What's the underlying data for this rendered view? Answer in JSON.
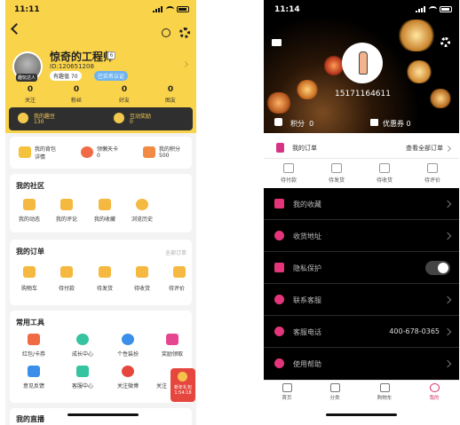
{
  "left": {
    "status_time": "11:11",
    "user": {
      "name": "惊奇的工程师",
      "id_text": "ID:120651208",
      "interest_badge": "有趣值 70",
      "verify_badge": "已实名认证",
      "avatar_tag": "趣玩达人"
    },
    "stats": [
      {
        "value": "0",
        "label": "关注"
      },
      {
        "value": "0",
        "label": "粉丝"
      },
      {
        "value": "0",
        "label": "好友"
      },
      {
        "value": "0",
        "label": "图友"
      }
    ],
    "beans": {
      "label": "我的趣豆",
      "value": "130"
    },
    "rewards": {
      "label": "互动奖励",
      "value": "0"
    },
    "quick": [
      {
        "label": "我的背包",
        "sub": "详情"
      },
      {
        "label": "领懒天卡",
        "sub": "0"
      },
      {
        "label": "我的积分",
        "sub": "500"
      }
    ],
    "community": {
      "title": "我的社区",
      "items": [
        "我的动态",
        "我的评论",
        "我的收藏",
        "浏览历史"
      ]
    },
    "orders": {
      "title": "我的订单",
      "all": "全部订单",
      "items": [
        "购物车",
        "待付款",
        "待发货",
        "待收货",
        "待评价"
      ]
    },
    "tools": {
      "title": "常用工具",
      "row1": [
        "红包/卡券",
        "成长中心",
        "个性装扮",
        "奖励领取"
      ],
      "row2": [
        "意见反馈",
        "客服中心",
        "关注微博",
        "关注"
      ]
    },
    "live_title": "我的直播",
    "float_badge": "新年礼包 1:54:18"
  },
  "right": {
    "status_time": "11:14",
    "phone": "15171164611",
    "points_label": "积分",
    "points_value": "0",
    "coupon_label": "优惠券",
    "coupon_value": "0",
    "orders_title": "我的订单",
    "orders_all": "查看全部订单",
    "order_status": [
      "待付款",
      "待发货",
      "待收货",
      "待评价"
    ],
    "menu": [
      {
        "label": "我的收藏"
      },
      {
        "label": "收货地址"
      },
      {
        "label": "隐私保护"
      },
      {
        "label": "联系客服"
      },
      {
        "label": "客服电话",
        "value": "400-678-0365"
      },
      {
        "label": "使用帮助"
      }
    ],
    "tabs": [
      "首页",
      "分类",
      "购物车",
      "我的"
    ]
  },
  "colors": {
    "yellow_header": "#f9d34a",
    "accent_pink": "#d6336c",
    "dark_bar": "#2f2f2f"
  }
}
